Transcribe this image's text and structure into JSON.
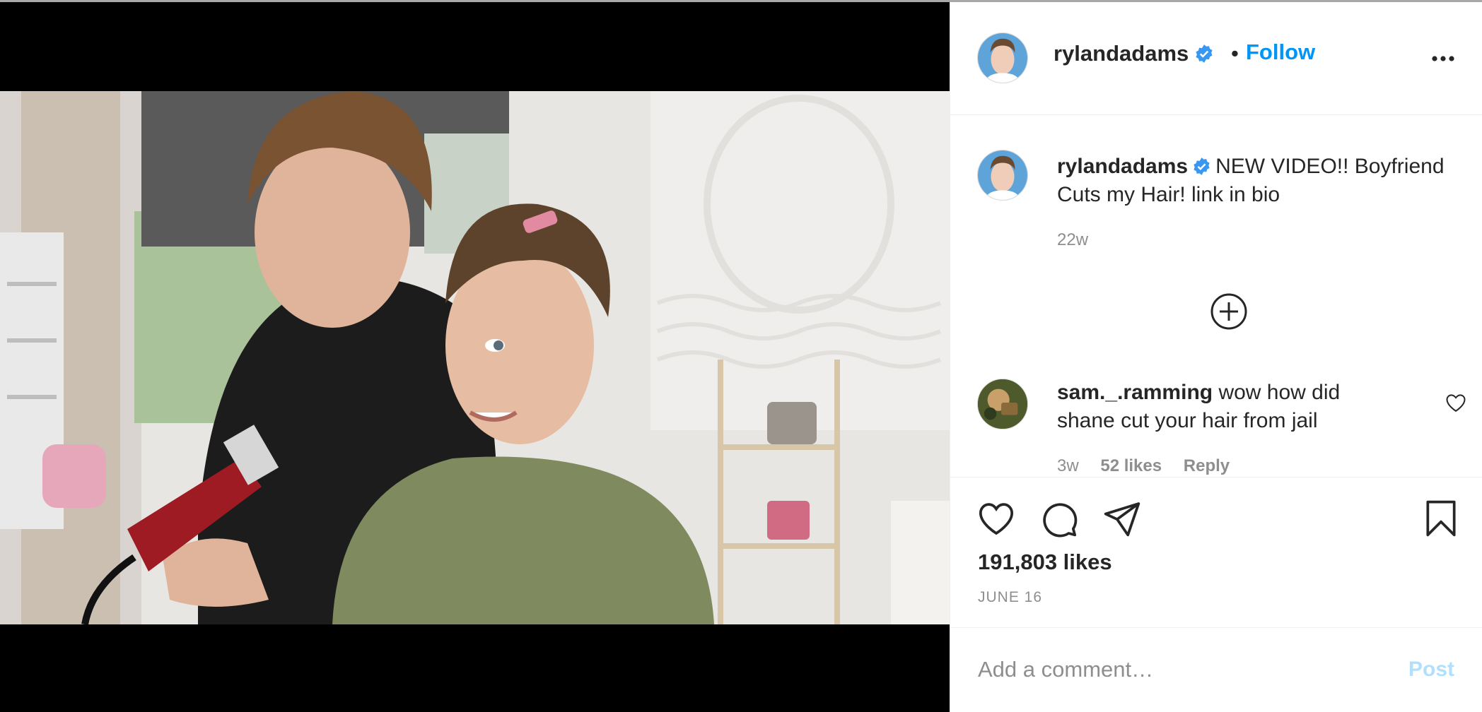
{
  "post": {
    "author": {
      "username": "rylandadams",
      "verified_icon": "verified-badge-icon",
      "follow_label": "Follow",
      "separator": "•"
    },
    "more_icon": "more-options-icon",
    "caption": {
      "username": "rylandadams",
      "text": "NEW VIDEO!! Boyfriend Cuts my Hair! link in bio",
      "age": "22w"
    },
    "load_more_icon": "plus-circle-icon",
    "comments": [
      {
        "username": "sam._.ramming",
        "text": "wow how did shane cut your hair from jail",
        "age": "3w",
        "likes": "52 likes",
        "reply_label": "Reply"
      }
    ],
    "actions": {
      "like_icon": "heart-icon",
      "comment_icon": "comment-bubble-icon",
      "share_icon": "paper-plane-icon",
      "save_icon": "bookmark-icon"
    },
    "likes_count": "191,803 likes",
    "date": "JUNE 16",
    "add_comment": {
      "placeholder": "Add a comment…",
      "post_label": "Post"
    }
  },
  "colors": {
    "link_blue": "#0095f6",
    "post_disabled": "#b2dffc",
    "muted_text": "#8e8e8e",
    "verified_blue": "#3897f0"
  }
}
